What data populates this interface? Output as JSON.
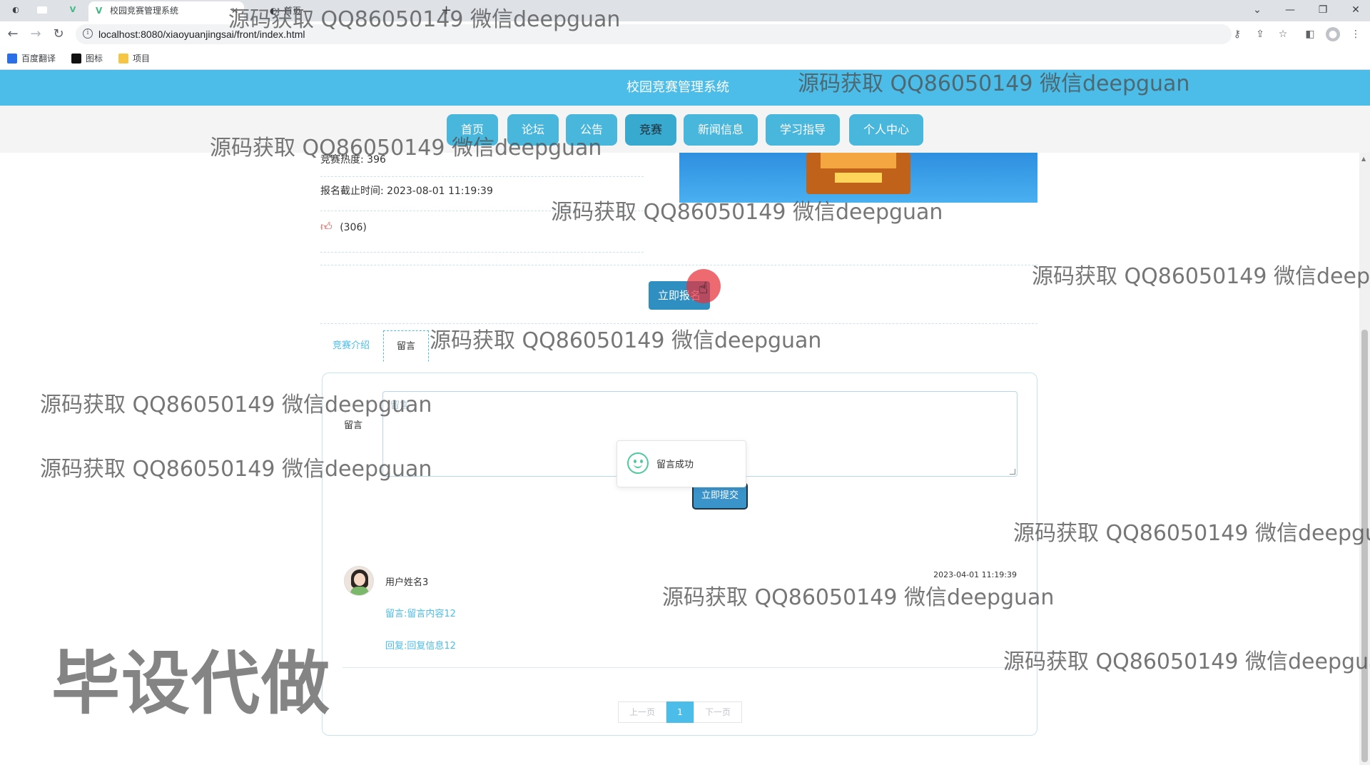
{
  "browser": {
    "tabs": [
      {
        "title": ""
      },
      {
        "title": ""
      },
      {
        "title": ""
      },
      {
        "title": "校园竞赛管理系统"
      },
      {
        "title": "首页"
      }
    ],
    "new_tab_label": "+",
    "url": "localhost:8080/xiaoyuanjingsai/front/index.html",
    "bookmarks": [
      {
        "label": "百度翻译",
        "color": "#2a6ee8"
      },
      {
        "label": "图标",
        "color": "#111111"
      },
      {
        "label": "项目",
        "color": "#f6c544"
      }
    ]
  },
  "site": {
    "title": "校园竞赛管理系统",
    "nav": [
      {
        "label": "首页",
        "active": false
      },
      {
        "label": "论坛",
        "active": false
      },
      {
        "label": "公告",
        "active": false
      },
      {
        "label": "竞赛",
        "active": true
      },
      {
        "label": "新闻信息",
        "active": false
      },
      {
        "label": "学习指导",
        "active": false
      },
      {
        "label": "个人中心",
        "active": false
      }
    ]
  },
  "competition": {
    "heat": "竞赛热度: 396",
    "deadline": "报名截止时间: 2023-08-01 11:19:39",
    "likes": "(306)",
    "enroll_button": "立即报名"
  },
  "detail_tabs": {
    "intro": "竞赛介绍",
    "message": "留言"
  },
  "message_form": {
    "label": "留言",
    "placeholder": "留言",
    "submit": "立即提交",
    "toast": "留言成功"
  },
  "comments": [
    {
      "user": "用户姓名3",
      "time": "2023-04-01 11:19:39",
      "content": "留言:留言内容12",
      "reply": "回复:回复信息12"
    }
  ],
  "pagination": {
    "prev": "上一页",
    "current": "1",
    "next": "下一页"
  },
  "watermarks": {
    "text": "源码获取 QQ86050149 微信deepguan",
    "big": "毕设代做"
  },
  "colors": {
    "header": "#4bbde8",
    "nav_button": "#49b6dc",
    "accent": "#4bbde8",
    "toast_icon": "#4ec9a0",
    "cursor_highlight": "#e8303a"
  }
}
